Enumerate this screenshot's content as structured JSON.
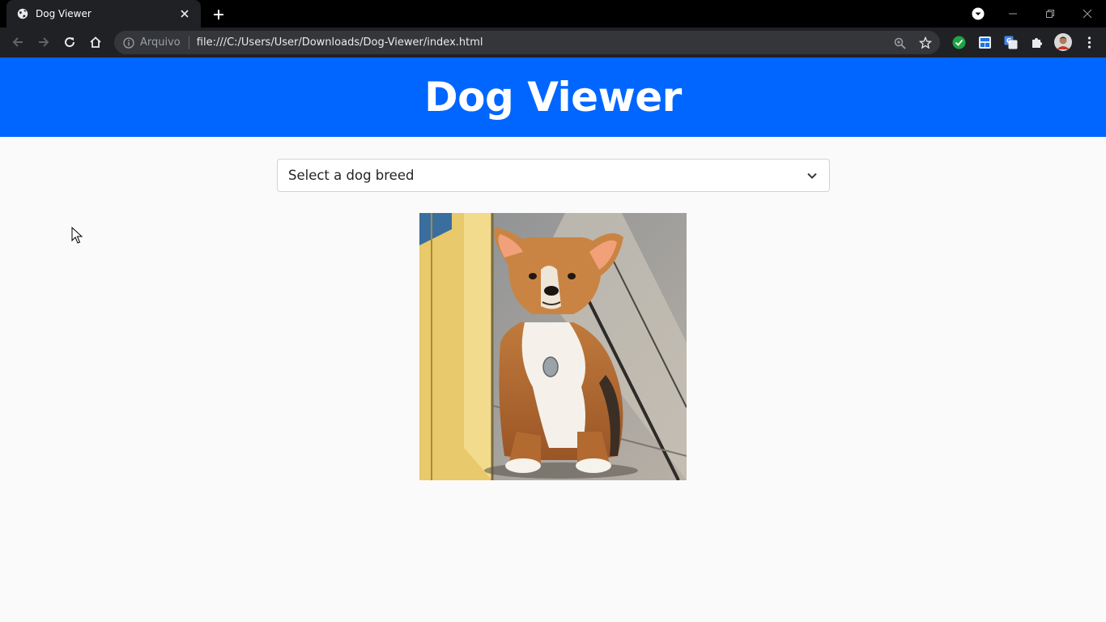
{
  "browser": {
    "tab": {
      "title": "Dog Viewer",
      "favicon": "globe-icon",
      "close": "close-icon"
    },
    "new_tab_icon": "plus-icon",
    "tab_search_icon": "chevron-down-circle-icon",
    "window_controls": [
      "minimize-icon",
      "restore-icon",
      "close-icon"
    ],
    "nav": {
      "back": "arrow-left-icon",
      "forward": "arrow-right-icon",
      "reload": "reload-icon",
      "home": "home-icon"
    },
    "omnibox": {
      "security_icon": "info-icon",
      "scheme_label": "Arquivo",
      "url": "file:///C:/Users/User/Downloads/Dog-Viewer/index.html",
      "zoom_icon": "zoom-icon",
      "bookmark_icon": "star-icon"
    },
    "extensions": [
      "green-check-extension-icon",
      "translate-page-extension-icon",
      "google-translate-icon",
      "puzzle-icon",
      "profile-avatar",
      "kebab-menu-icon"
    ],
    "colors": {
      "tabbar": "#000000",
      "toolbar": "#202124",
      "omnibox": "#35363a"
    }
  },
  "page": {
    "header_title": "Dog Viewer",
    "breed_select": {
      "selected": "Select a dog breed"
    },
    "image": {
      "subject": "corgi-photo"
    },
    "colors": {
      "header_bg": "#0066ff",
      "body_bg": "#fafafa"
    }
  }
}
